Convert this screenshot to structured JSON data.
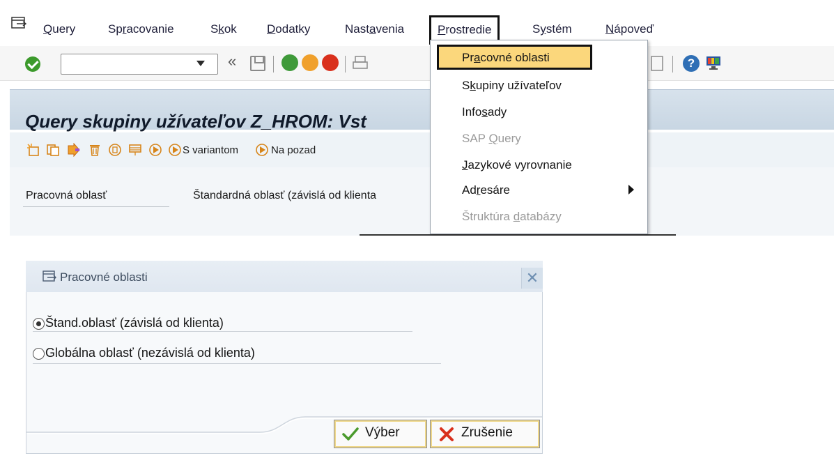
{
  "menubar": {
    "items": [
      {
        "pre": "",
        "ul": "Q",
        "post": "uery"
      },
      {
        "pre": "Sp",
        "ul": "r",
        "post": "acovanie"
      },
      {
        "pre": "S",
        "ul": "k",
        "post": "ok"
      },
      {
        "pre": "",
        "ul": "D",
        "post": "odatky"
      },
      {
        "pre": "Nast",
        "ul": "a",
        "post": "venia"
      },
      {
        "pre": "",
        "ul": "P",
        "post": "rostredie"
      },
      {
        "pre": "S",
        "ul": "y",
        "post": "stém"
      },
      {
        "pre": "",
        "ul": "N",
        "post": "ápoveď"
      }
    ]
  },
  "toolbar": {
    "command_value": "",
    "nav_glyph": "«"
  },
  "page": {
    "title": "Query skupiny užívateľov Z_HROM: Vst",
    "app_toolbar": {
      "with_variant_label": "S variantom",
      "background_label": "Na pozad"
    },
    "work_area_label": "Pracovná oblasť",
    "work_area_value": "Štandardná oblasť (závislá od klienta"
  },
  "dropdown": {
    "items": [
      {
        "pre": "Pr",
        "ul": "a",
        "post": "covné oblasti",
        "enabled": true,
        "submenu": false
      },
      {
        "pre": "S",
        "ul": "k",
        "post": "upiny užívateľov",
        "enabled": true,
        "submenu": false
      },
      {
        "pre": "Info",
        "ul": "s",
        "post": "ady",
        "enabled": true,
        "submenu": false
      },
      {
        "pre": "SAP ",
        "ul": "Q",
        "post": "uery",
        "enabled": false,
        "submenu": false
      },
      {
        "pre": "",
        "ul": "J",
        "post": "azykové vyrovnanie",
        "enabled": true,
        "submenu": false
      },
      {
        "pre": "Ad",
        "ul": "r",
        "post": "esáre",
        "enabled": true,
        "submenu": true
      },
      {
        "pre": "Štruktúra ",
        "ul": "d",
        "post": "atabázy",
        "enabled": false,
        "submenu": false
      }
    ]
  },
  "dialog": {
    "title": "Pracovné oblasti",
    "close_glyph": "✕",
    "options": [
      {
        "label": "Štand.oblasť (závislá od klienta)",
        "checked": true
      },
      {
        "label": "Globálna oblasť (nezávislá od klienta)",
        "checked": false
      }
    ],
    "buttons": {
      "select_label": "Výber",
      "cancel_label": "Zrušenie"
    }
  },
  "colors": {
    "highlight": "#fbd77c",
    "title_band": "#d7e2ec",
    "ok_green": "#3c9a2c",
    "cancel_red": "#d9301c"
  }
}
